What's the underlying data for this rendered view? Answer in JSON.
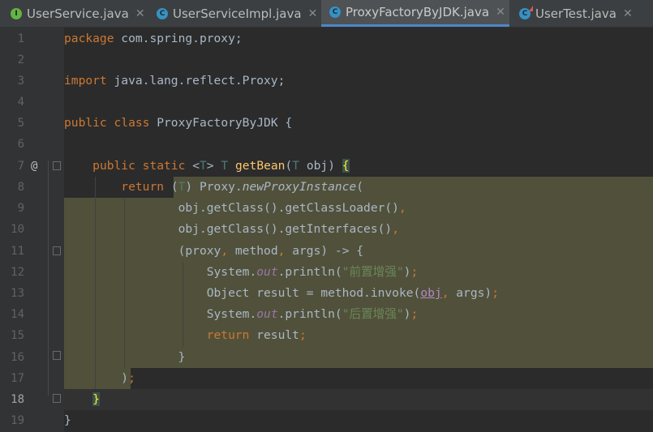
{
  "tabs": [
    {
      "name": "UserService.java",
      "icon": "interface-icon",
      "icon_letter": "I",
      "active": false,
      "close": "✕"
    },
    {
      "name": "UserServiceImpl.java",
      "icon": "class-icon",
      "icon_letter": "C",
      "active": false,
      "close": "✕"
    },
    {
      "name": "ProxyFactoryByJDK.java",
      "icon": "class-icon",
      "icon_letter": "C",
      "active": true,
      "close": "✕"
    },
    {
      "name": "UserTest.java",
      "icon": "test-class-icon",
      "icon_letter": "C",
      "active": false,
      "close": "✕"
    }
  ],
  "gutter": {
    "line_numbers": [
      "1",
      "2",
      "3",
      "4",
      "5",
      "6",
      "7",
      "8",
      "9",
      "10",
      "11",
      "12",
      "13",
      "14",
      "15",
      "16",
      "17",
      "18",
      "19"
    ],
    "override_marker": "@"
  },
  "code": {
    "l1": {
      "kw": "package",
      "rest": " com.spring.proxy;"
    },
    "l3": {
      "kw": "import",
      "rest": " java.lang.reflect.Proxy;"
    },
    "l5": {
      "kw1": "public",
      "kw2": "class",
      "name": " ProxyFactoryByJDK {"
    },
    "l7": {
      "kw1": "public",
      "kw2": "static",
      "lt": "<",
      "t1": "T",
      "gt": ">",
      "t2": "T",
      "fn": "getBean",
      "open": "(",
      "t3": "T",
      "param": " obj) ",
      "brace": "{"
    },
    "l8": {
      "kw": "return",
      "p1": "(",
      "t": "T",
      "p2": ") Proxy.",
      "m": "newProxyInstance",
      "p3": "("
    },
    "l9": {
      "text": "obj.getClass().getClassLoader()",
      "comma": ","
    },
    "l10": {
      "text": "obj.getClass().getInterfaces()",
      "comma": ","
    },
    "l11": {
      "open": "(proxy",
      "c1": ",",
      "m": " method",
      "c2": ",",
      "rest": " args) -> {"
    },
    "l12": {
      "a": "System.",
      "f": "out",
      "b": ".println(",
      "s": "\"前置增强\"",
      "c": ")",
      "semi": ";"
    },
    "l13": {
      "a": "Object result = method.invoke(",
      "o": "obj",
      "c1": ",",
      "b": " args)",
      "semi": ";"
    },
    "l14": {
      "a": "System.",
      "f": "out",
      "b": ".println(",
      "s": "\"后置增强\"",
      "c": ")",
      "semi": ";"
    },
    "l15": {
      "kw": "return",
      "rest": " result",
      "semi": ";"
    },
    "l16": {
      "text": "}"
    },
    "l17": {
      "text": ")",
      "semi": ";"
    },
    "l18": {
      "brace": "}"
    },
    "l19": {
      "text": "}"
    }
  }
}
